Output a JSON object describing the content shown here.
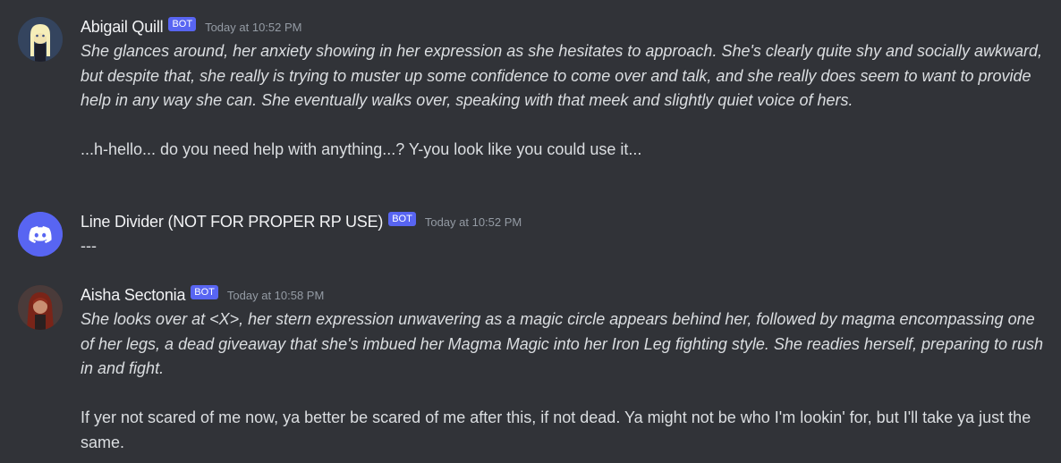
{
  "messages": [
    {
      "author": "Abigail Quill",
      "bot_tag": "BOT",
      "timestamp": "Today at 10:52 PM",
      "action": "She glances around, her anxiety showing in her expression as she hesitates to approach. She's clearly quite shy and socially awkward, but despite that, she really is trying to muster up some confidence to come over and talk, and she really does seem to want to provide help in any way she can. She eventually walks over, speaking with that meek and slightly quiet voice of hers.",
      "speech": "...h-hello... do you need help with anything...? Y-you look like you could use it...",
      "avatar_icon": "anime-character-avatar"
    },
    {
      "author": "Line Divider (NOT FOR PROPER RP USE)",
      "bot_tag": "BOT",
      "timestamp": "Today at 10:52 PM",
      "content": "---",
      "avatar_icon": "discord-logo-icon"
    },
    {
      "author": "Aisha Sectonia",
      "bot_tag": "BOT",
      "timestamp": "Today at 10:58 PM",
      "action": "She looks over at <X>, her stern expression unwavering as a magic circle appears behind her, followed by magma encompassing one of her legs, a dead giveaway that she's imbued her Magma Magic into her Iron Leg fighting style. She readies herself, preparing to rush in and fight.",
      "speech": "If yer not scared of me now, ya better be scared of me after this, if not dead. Ya might not be who I'm lookin' for, but I'll take ya just the same.",
      "avatar_icon": "red-haired-character-avatar"
    }
  ],
  "colors": {
    "background": "#313338",
    "bot_tag": "#5865f2",
    "username": "#f2f3f5",
    "text": "#dbdee1",
    "timestamp": "#949ba4"
  }
}
